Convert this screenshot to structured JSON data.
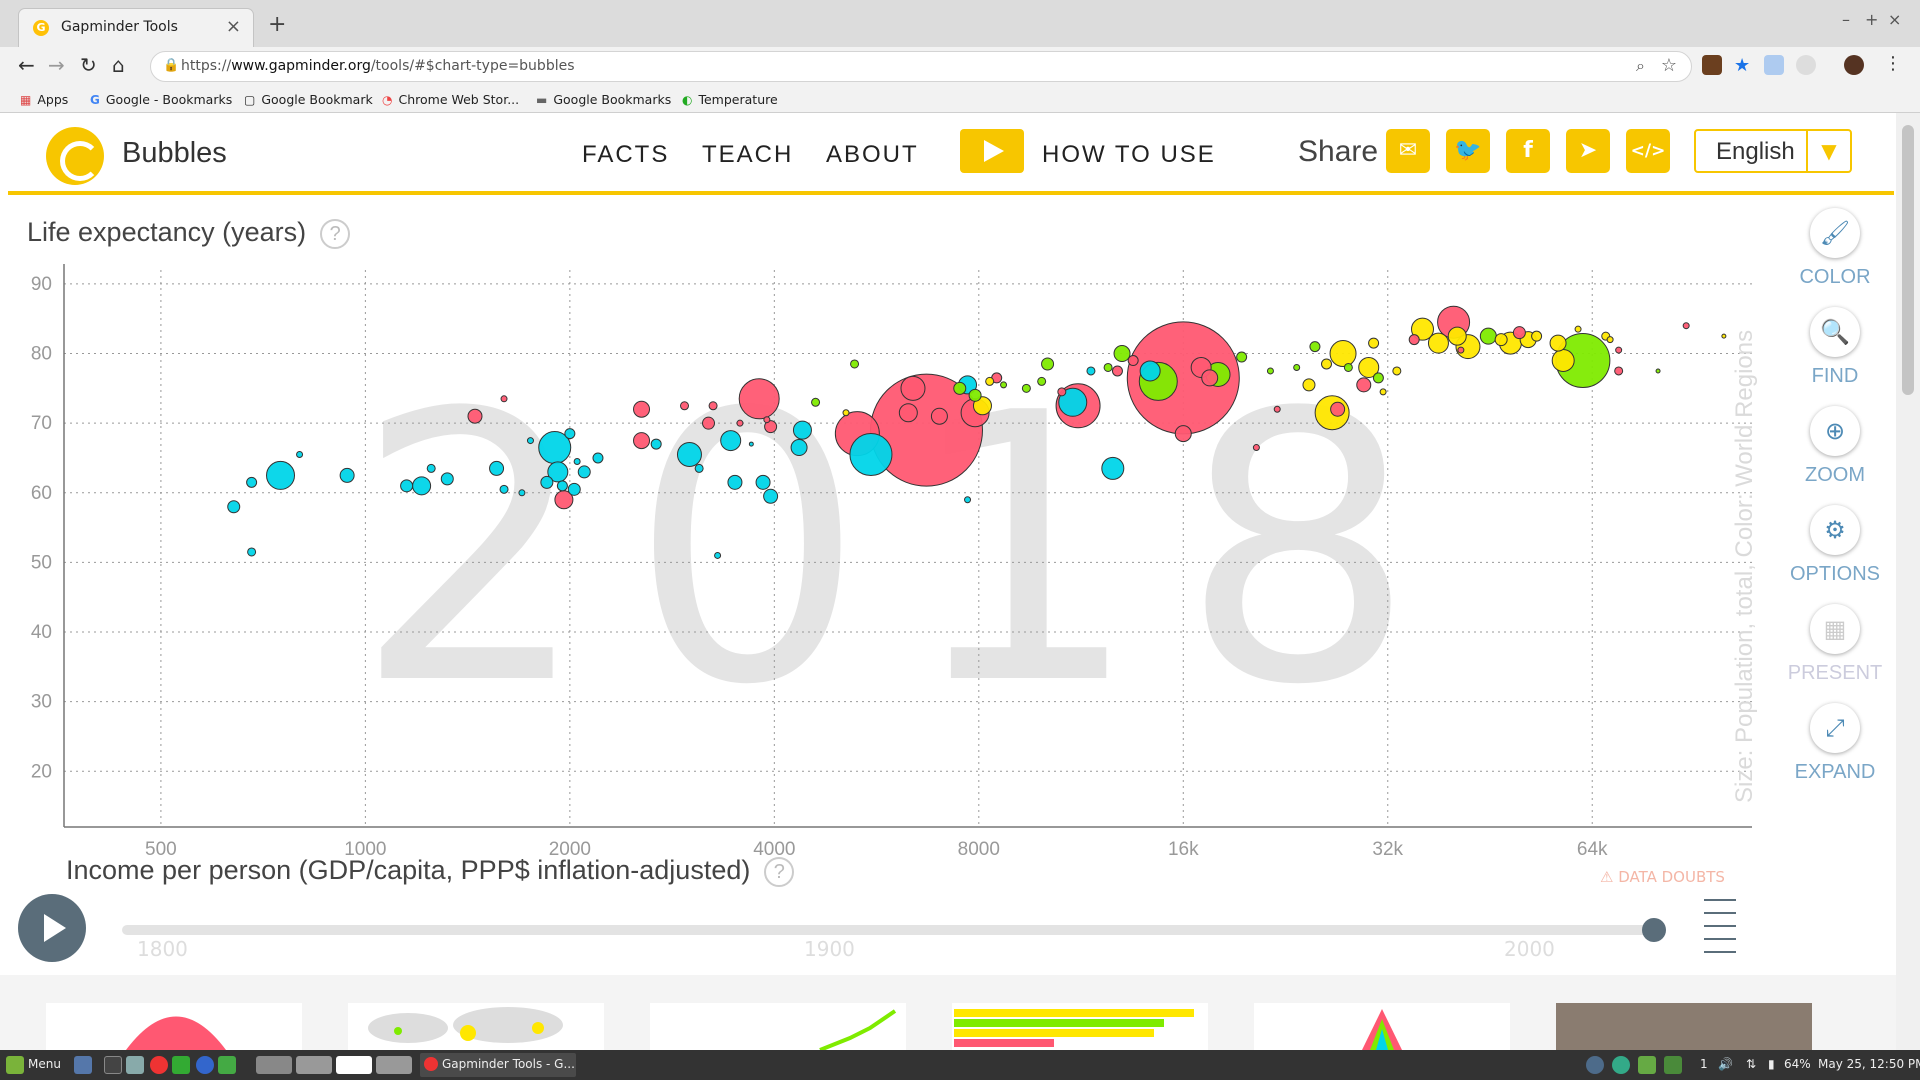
{
  "browser": {
    "tab_title": "Gapminder Tools",
    "url_scheme": "https://",
    "url_host": "www.gapminder.org",
    "url_path": "/tools/#$chart-type=bubbles",
    "bookmarks": [
      "Apps",
      "Google - Bookmarks",
      "Google Bookmark",
      "Chrome Web Stor...",
      "Google Bookmarks",
      "Temperature"
    ]
  },
  "header": {
    "app_name": "Bubbles",
    "menu": [
      "FACTS",
      "TEACH",
      "ABOUT"
    ],
    "how_to_use": "HOW TO USE",
    "share_label": "Share",
    "language": "English"
  },
  "chart": {
    "y_title": "Life expectancy (years)",
    "x_title": "Income per person (GDP/capita, PPP$ inflation-adjusted)",
    "size_color_label": "Size: Population, total, Color: World Regions",
    "year_watermark": "2018",
    "data_doubts": "DATA DOUBTS"
  },
  "chart_data": {
    "type": "scatter",
    "x_scale": "log",
    "xlim": [
      360,
      110000
    ],
    "ylim": [
      12,
      92
    ],
    "x_ticks": [
      500,
      1000,
      2000,
      4000,
      8000,
      16000,
      32000,
      64000
    ],
    "x_tick_labels": [
      "500",
      "1000",
      "2000",
      "4000",
      "8000",
      "16k",
      "32k",
      "64k"
    ],
    "y_ticks": [
      20,
      30,
      40,
      50,
      60,
      70,
      80,
      90
    ],
    "region_colors": {
      "africa": "#00d5e9",
      "americas": "#7feb00",
      "asia": "#ff5872",
      "europe": "#ffe700"
    },
    "points": [
      {
        "x": 640,
        "y": 58,
        "r": 6,
        "region": "africa"
      },
      {
        "x": 680,
        "y": 51.5,
        "r": 4,
        "region": "africa"
      },
      {
        "x": 680,
        "y": 61.5,
        "r": 5,
        "region": "africa"
      },
      {
        "x": 750,
        "y": 62.5,
        "r": 14,
        "region": "africa"
      },
      {
        "x": 800,
        "y": 65.5,
        "r": 3,
        "region": "africa"
      },
      {
        "x": 940,
        "y": 62.5,
        "r": 7,
        "region": "africa"
      },
      {
        "x": 1150,
        "y": 61,
        "r": 6,
        "region": "africa"
      },
      {
        "x": 1210,
        "y": 61,
        "r": 9,
        "region": "africa"
      },
      {
        "x": 1250,
        "y": 63.5,
        "r": 4,
        "region": "africa"
      },
      {
        "x": 1320,
        "y": 62,
        "r": 6,
        "region": "africa"
      },
      {
        "x": 1450,
        "y": 71,
        "r": 7,
        "region": "asia"
      },
      {
        "x": 1560,
        "y": 63.5,
        "r": 7,
        "region": "africa"
      },
      {
        "x": 1600,
        "y": 60.5,
        "r": 4,
        "region": "africa"
      },
      {
        "x": 1600,
        "y": 73.5,
        "r": 3,
        "region": "asia"
      },
      {
        "x": 1700,
        "y": 60,
        "r": 3,
        "region": "africa"
      },
      {
        "x": 1750,
        "y": 67.5,
        "r": 3,
        "region": "africa"
      },
      {
        "x": 1850,
        "y": 61.5,
        "r": 6,
        "region": "africa"
      },
      {
        "x": 1900,
        "y": 66.5,
        "r": 16,
        "region": "africa"
      },
      {
        "x": 1920,
        "y": 63,
        "r": 10,
        "region": "africa"
      },
      {
        "x": 1950,
        "y": 61,
        "r": 5,
        "region": "africa"
      },
      {
        "x": 1960,
        "y": 59,
        "r": 9,
        "region": "asia"
      },
      {
        "x": 2000,
        "y": 68.5,
        "r": 5,
        "region": "africa"
      },
      {
        "x": 2030,
        "y": 60.5,
        "r": 6,
        "region": "africa"
      },
      {
        "x": 2050,
        "y": 64.5,
        "r": 3,
        "region": "africa"
      },
      {
        "x": 2100,
        "y": 63,
        "r": 6,
        "region": "africa"
      },
      {
        "x": 2200,
        "y": 65,
        "r": 5,
        "region": "africa"
      },
      {
        "x": 2550,
        "y": 67.5,
        "r": 8,
        "region": "asia"
      },
      {
        "x": 2550,
        "y": 72,
        "r": 8,
        "region": "asia"
      },
      {
        "x": 2680,
        "y": 67,
        "r": 5,
        "region": "africa"
      },
      {
        "x": 2950,
        "y": 72.5,
        "r": 4,
        "region": "asia"
      },
      {
        "x": 3000,
        "y": 65.5,
        "r": 12,
        "region": "africa"
      },
      {
        "x": 3100,
        "y": 63.5,
        "r": 4,
        "region": "africa"
      },
      {
        "x": 3200,
        "y": 70,
        "r": 6,
        "region": "asia"
      },
      {
        "x": 3250,
        "y": 72.5,
        "r": 4,
        "region": "asia"
      },
      {
        "x": 3300,
        "y": 51,
        "r": 3,
        "region": "africa"
      },
      {
        "x": 3450,
        "y": 67.5,
        "r": 10,
        "region": "africa"
      },
      {
        "x": 3500,
        "y": 61.5,
        "r": 7,
        "region": "africa"
      },
      {
        "x": 3560,
        "y": 70,
        "r": 3,
        "region": "asia"
      },
      {
        "x": 3700,
        "y": 67,
        "r": 2,
        "region": "africa"
      },
      {
        "x": 3800,
        "y": 73.5,
        "r": 20,
        "region": "asia"
      },
      {
        "x": 3850,
        "y": 61.5,
        "r": 7,
        "region": "africa"
      },
      {
        "x": 3900,
        "y": 70.5,
        "r": 3,
        "region": "asia"
      },
      {
        "x": 3950,
        "y": 69.5,
        "r": 6,
        "region": "asia"
      },
      {
        "x": 3950,
        "y": 59.5,
        "r": 7,
        "region": "africa"
      },
      {
        "x": 4350,
        "y": 66.5,
        "r": 8,
        "region": "africa"
      },
      {
        "x": 4400,
        "y": 69,
        "r": 9,
        "region": "africa"
      },
      {
        "x": 4600,
        "y": 73,
        "r": 4,
        "region": "americas"
      },
      {
        "x": 5100,
        "y": 71.5,
        "r": 3,
        "region": "europe"
      },
      {
        "x": 5250,
        "y": 78.5,
        "r": 4,
        "region": "americas"
      },
      {
        "x": 5300,
        "y": 68.5,
        "r": 22,
        "region": "asia"
      },
      {
        "x": 5550,
        "y": 65.5,
        "r": 21,
        "region": "africa"
      },
      {
        "x": 6700,
        "y": 69,
        "r": 56,
        "region": "asia"
      },
      {
        "x": 6300,
        "y": 71.5,
        "r": 9,
        "region": "asia"
      },
      {
        "x": 6400,
        "y": 75,
        "r": 12,
        "region": "asia"
      },
      {
        "x": 7000,
        "y": 71,
        "r": 8,
        "region": "asia"
      },
      {
        "x": 7500,
        "y": 75,
        "r": 6,
        "region": "americas"
      },
      {
        "x": 7700,
        "y": 75.5,
        "r": 9,
        "region": "africa"
      },
      {
        "x": 7700,
        "y": 59,
        "r": 3,
        "region": "africa"
      },
      {
        "x": 7900,
        "y": 74,
        "r": 6,
        "region": "americas"
      },
      {
        "x": 7900,
        "y": 71.5,
        "r": 14,
        "region": "asia"
      },
      {
        "x": 8100,
        "y": 72.5,
        "r": 9,
        "region": "europe"
      },
      {
        "x": 8300,
        "y": 76,
        "r": 4,
        "region": "europe"
      },
      {
        "x": 8500,
        "y": 76.5,
        "r": 5,
        "region": "asia"
      },
      {
        "x": 8700,
        "y": 75.5,
        "r": 3,
        "region": "americas"
      },
      {
        "x": 9400,
        "y": 75,
        "r": 4,
        "region": "americas"
      },
      {
        "x": 9900,
        "y": 76,
        "r": 4,
        "region": "americas"
      },
      {
        "x": 10100,
        "y": 78.5,
        "r": 6,
        "region": "americas"
      },
      {
        "x": 10600,
        "y": 74.5,
        "r": 4,
        "region": "asia"
      },
      {
        "x": 11200,
        "y": 72.5,
        "r": 22,
        "region": "asia"
      },
      {
        "x": 11000,
        "y": 73,
        "r": 14,
        "region": "africa"
      },
      {
        "x": 11700,
        "y": 77.5,
        "r": 4,
        "region": "africa"
      },
      {
        "x": 12400,
        "y": 78,
        "r": 4,
        "region": "americas"
      },
      {
        "x": 12600,
        "y": 63.5,
        "r": 11,
        "region": "africa"
      },
      {
        "x": 13000,
        "y": 80,
        "r": 8,
        "region": "americas"
      },
      {
        "x": 12800,
        "y": 77.5,
        "r": 5,
        "region": "asia"
      },
      {
        "x": 13500,
        "y": 79,
        "r": 5,
        "region": "asia"
      },
      {
        "x": 14300,
        "y": 77.5,
        "r": 10,
        "region": "africa"
      },
      {
        "x": 14700,
        "y": 76,
        "r": 19,
        "region": "americas"
      },
      {
        "x": 16000,
        "y": 76.5,
        "r": 56,
        "region": "asia"
      },
      {
        "x": 16000,
        "y": 68.5,
        "r": 8,
        "region": "asia"
      },
      {
        "x": 17000,
        "y": 78,
        "r": 10,
        "region": "asia"
      },
      {
        "x": 17500,
        "y": 76.5,
        "r": 8,
        "region": "asia"
      },
      {
        "x": 18000,
        "y": 77,
        "r": 12,
        "region": "americas"
      },
      {
        "x": 19500,
        "y": 79.5,
        "r": 5,
        "region": "americas"
      },
      {
        "x": 20500,
        "y": 66.5,
        "r": 3,
        "region": "asia"
      },
      {
        "x": 21500,
        "y": 77.5,
        "r": 3,
        "region": "americas"
      },
      {
        "x": 22000,
        "y": 72,
        "r": 3,
        "region": "asia"
      },
      {
        "x": 23500,
        "y": 78,
        "r": 3,
        "region": "americas"
      },
      {
        "x": 24500,
        "y": 75.5,
        "r": 6,
        "region": "europe"
      },
      {
        "x": 25000,
        "y": 81,
        "r": 5,
        "region": "americas"
      },
      {
        "x": 26000,
        "y": 78.5,
        "r": 5,
        "region": "europe"
      },
      {
        "x": 26500,
        "y": 71.5,
        "r": 17,
        "region": "europe"
      },
      {
        "x": 27000,
        "y": 72,
        "r": 7,
        "region": "asia"
      },
      {
        "x": 27500,
        "y": 80,
        "r": 13,
        "region": "europe"
      },
      {
        "x": 28000,
        "y": 78,
        "r": 4,
        "region": "americas"
      },
      {
        "x": 29500,
        "y": 75.5,
        "r": 7,
        "region": "asia"
      },
      {
        "x": 30000,
        "y": 78,
        "r": 10,
        "region": "europe"
      },
      {
        "x": 30500,
        "y": 81.5,
        "r": 5,
        "region": "europe"
      },
      {
        "x": 31000,
        "y": 76.5,
        "r": 5,
        "region": "americas"
      },
      {
        "x": 31500,
        "y": 74.5,
        "r": 3,
        "region": "europe"
      },
      {
        "x": 33000,
        "y": 77.5,
        "r": 4,
        "region": "europe"
      },
      {
        "x": 35000,
        "y": 82,
        "r": 5,
        "region": "asia"
      },
      {
        "x": 36000,
        "y": 83.5,
        "r": 11,
        "region": "europe"
      },
      {
        "x": 38000,
        "y": 81.5,
        "r": 10,
        "region": "europe"
      },
      {
        "x": 40000,
        "y": 84.5,
        "r": 16,
        "region": "asia"
      },
      {
        "x": 40500,
        "y": 82.5,
        "r": 9,
        "region": "europe"
      },
      {
        "x": 41000,
        "y": 80.5,
        "r": 3,
        "region": "asia"
      },
      {
        "x": 42000,
        "y": 81,
        "r": 12,
        "region": "europe"
      },
      {
        "x": 45000,
        "y": 82.5,
        "r": 8,
        "region": "americas"
      },
      {
        "x": 47000,
        "y": 82,
        "r": 6,
        "region": "europe"
      },
      {
        "x": 48500,
        "y": 81.5,
        "r": 11,
        "region": "europe"
      },
      {
        "x": 50000,
        "y": 83,
        "r": 6,
        "region": "asia"
      },
      {
        "x": 51500,
        "y": 82,
        "r": 8,
        "region": "europe"
      },
      {
        "x": 53000,
        "y": 82.5,
        "r": 5,
        "region": "europe"
      },
      {
        "x": 57000,
        "y": 81.5,
        "r": 8,
        "region": "europe"
      },
      {
        "x": 58000,
        "y": 79,
        "r": 11,
        "region": "europe"
      },
      {
        "x": 62000,
        "y": 79,
        "r": 27,
        "region": "americas"
      },
      {
        "x": 61000,
        "y": 83.5,
        "r": 3,
        "region": "europe"
      },
      {
        "x": 67000,
        "y": 82.5,
        "r": 4,
        "region": "europe"
      },
      {
        "x": 68000,
        "y": 82,
        "r": 3,
        "region": "europe"
      },
      {
        "x": 70000,
        "y": 80.5,
        "r": 3,
        "region": "asia"
      },
      {
        "x": 70000,
        "y": 77.5,
        "r": 4,
        "region": "asia"
      },
      {
        "x": 80000,
        "y": 77.5,
        "r": 2,
        "region": "americas"
      },
      {
        "x": 88000,
        "y": 84,
        "r": 3,
        "region": "asia"
      },
      {
        "x": 100000,
        "y": 82.5,
        "r": 2,
        "region": "europe"
      }
    ]
  },
  "tools": [
    "COLOR",
    "FIND",
    "ZOOM",
    "OPTIONS",
    "PRESENT",
    "EXPAND"
  ],
  "timeslider": {
    "years": [
      "1800",
      "1900",
      "2000"
    ],
    "current_year": 2018
  },
  "taskbar": {
    "menu": "Menu",
    "window": "Gapminder Tools - G...",
    "status": "64%",
    "clock": "May 25, 12:50 PM",
    "notif": "1"
  }
}
